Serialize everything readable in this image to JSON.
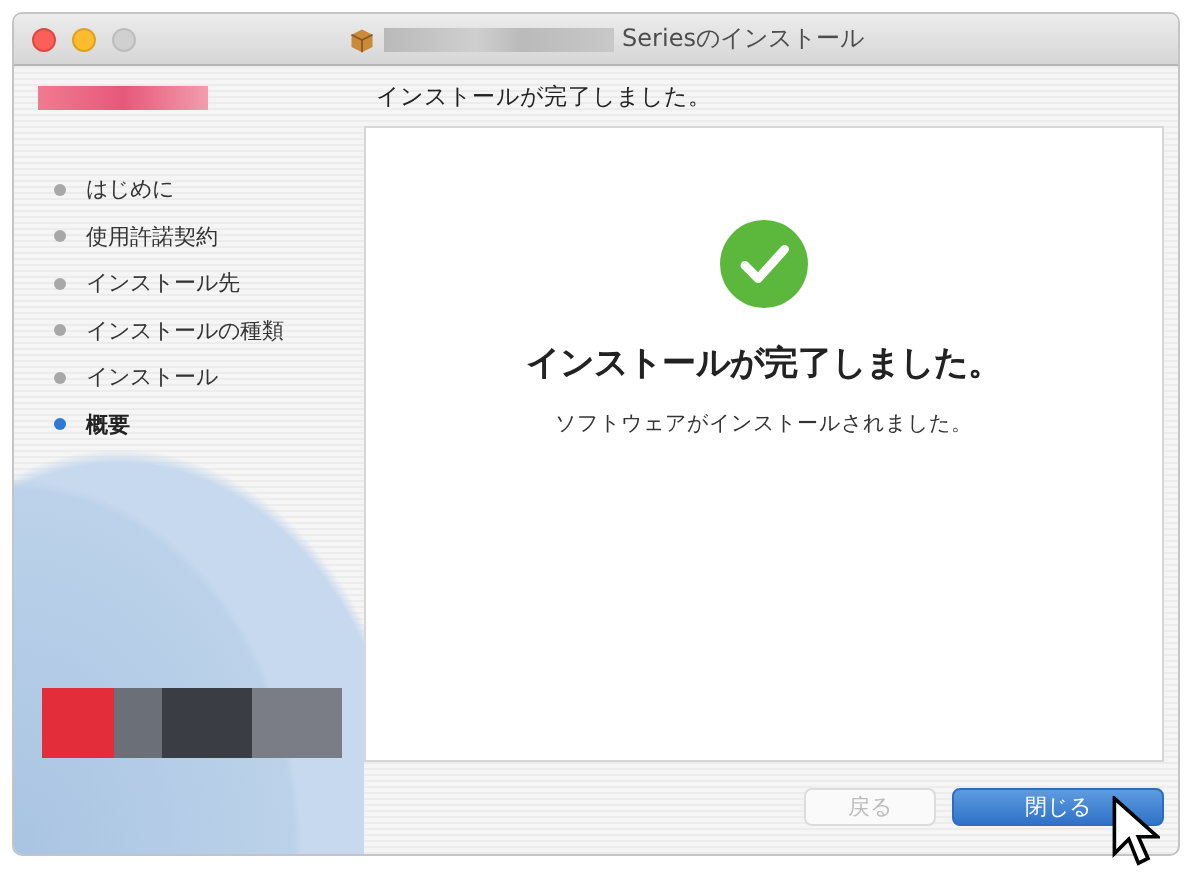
{
  "window": {
    "title": "Seriesのインストール"
  },
  "header": {
    "text": "インストールが完了しました。"
  },
  "sidebar": {
    "items": [
      {
        "label": "はじめに",
        "selected": false
      },
      {
        "label": "使用許諾契約",
        "selected": false
      },
      {
        "label": "インストール先",
        "selected": false
      },
      {
        "label": "インストールの種類",
        "selected": false
      },
      {
        "label": "インストール",
        "selected": false
      },
      {
        "label": "概要",
        "selected": true
      }
    ]
  },
  "content": {
    "heading": "インストールが完了しました。",
    "message": "ソフトウェアがインストールされました。"
  },
  "buttons": [
    {
      "label": "戻る",
      "disabled": true
    },
    {
      "label": "閉じる",
      "disabled": false
    }
  ]
}
